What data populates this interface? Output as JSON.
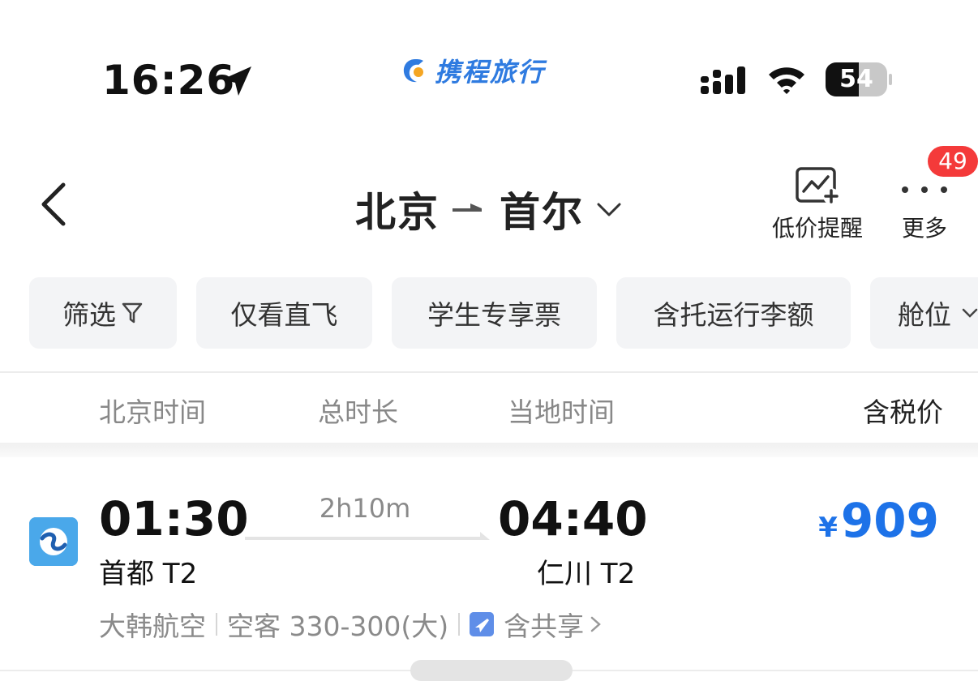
{
  "status_bar": {
    "time": "16:26",
    "battery": "54",
    "battery_level": 0.54,
    "icons": [
      "location-arrow-icon",
      "cellular-signal-icon",
      "wifi-icon",
      "battery-icon"
    ]
  },
  "brand": {
    "name": "携程旅行",
    "color": "#2f7be0"
  },
  "header": {
    "origin": "北京",
    "destination": "首尔",
    "price_alert_label": "低价提醒",
    "more_label": "更多",
    "badge_count": "49"
  },
  "filters": [
    "筛选",
    "仅看直飞",
    "学生专享票",
    "含托运行李额",
    "舱位"
  ],
  "columns": {
    "depart_time": "北京时间",
    "duration": "总时长",
    "arrive_time": "当地时间",
    "price": "含税价"
  },
  "flight": {
    "depart_time": "01:30",
    "arrive_time": "04:40",
    "duration": "2h10m",
    "depart_airport": "首都 T2",
    "arrive_airport": "仁川 T2",
    "price_symbol": "¥",
    "price": "909",
    "airline": "大韩航空",
    "aircraft": "空客 330-300(大)",
    "codeshare": "含共享"
  },
  "colors": {
    "accent": "#1d72e8",
    "badge": "#f43a3a",
    "chip_bg": "#f3f4f6",
    "airline_logo": "#4aa8ea"
  }
}
